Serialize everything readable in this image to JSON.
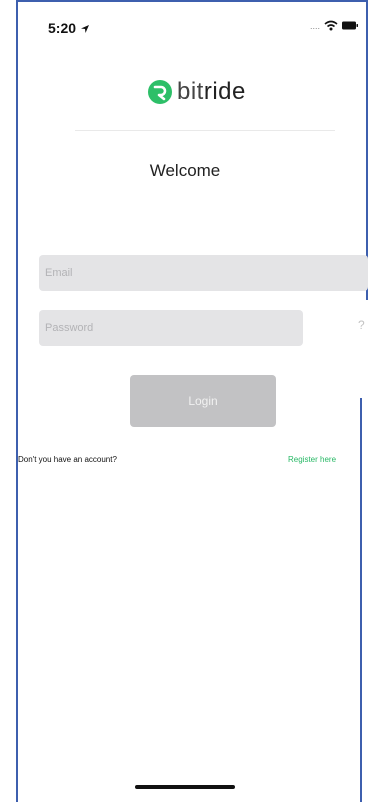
{
  "status_bar": {
    "time": "5:20",
    "signal_dots": "...."
  },
  "brand": {
    "prefix": "bit",
    "suffix": "ride",
    "color": "#2dbf68"
  },
  "welcome_text": "Welcome",
  "form": {
    "email_placeholder": "Email",
    "email_value": "",
    "password_placeholder": "Password",
    "password_value": "",
    "help_icon": "?",
    "login_label": "Login"
  },
  "footer": {
    "question": "Don't you have an account?",
    "register_label": "Register here"
  },
  "colors": {
    "accent": "#27b865",
    "field_background": "#e4e4e6",
    "button_disabled": "#c2c2c4"
  },
  "icons": {
    "location": "location-arrow-icon",
    "wifi": "wifi-icon",
    "battery": "battery-icon",
    "logo": "bitride-logo-icon"
  }
}
